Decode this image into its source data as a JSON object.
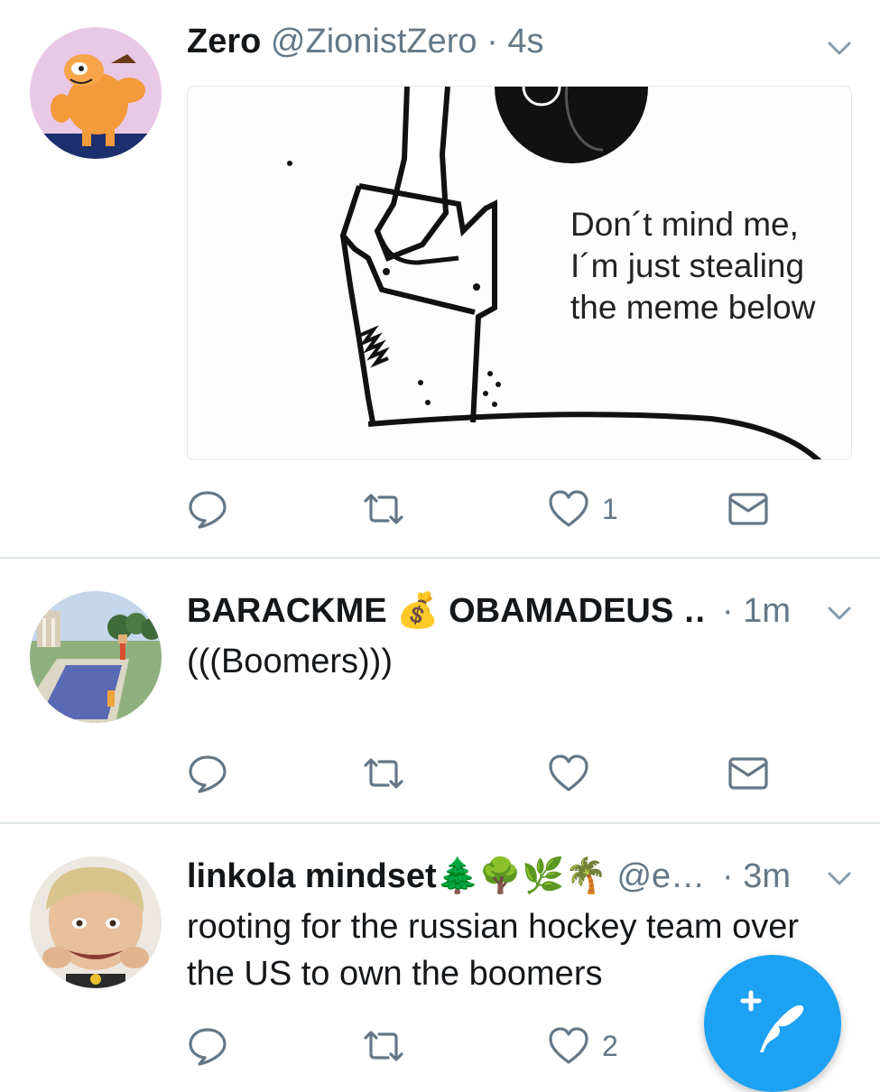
{
  "tweets": [
    {
      "name": "Zero",
      "handle": "@ZionistZero",
      "separator": "·",
      "time": "4s",
      "media": {
        "caption_line1": "Don´t mind me,",
        "caption_line2": "I´m just stealing",
        "caption_line3": "the meme below"
      },
      "likes": "1",
      "avatar_icon": "garfield-avatar"
    },
    {
      "name": "BARACKME 💰 OBAMADEUS …",
      "separator": "·",
      "time": "1m",
      "text": "(((Boomers)))",
      "avatar_icon": "pool-painting-avatar"
    },
    {
      "name": "linkola mindset🌲🌳🌿🌴",
      "handle": "@e…",
      "separator": "·",
      "time": "3m",
      "text_line1": "rooting for the russian hockey team over",
      "text_line2": "the US to own the boomers",
      "likes": "2",
      "avatar_icon": "child-face-avatar"
    }
  ],
  "colors": {
    "accent": "#1da1f2",
    "icon_gray": "#657786",
    "divider": "#e1e8ed",
    "text": "#14171a"
  },
  "fab_icon": "compose-tweet-icon"
}
